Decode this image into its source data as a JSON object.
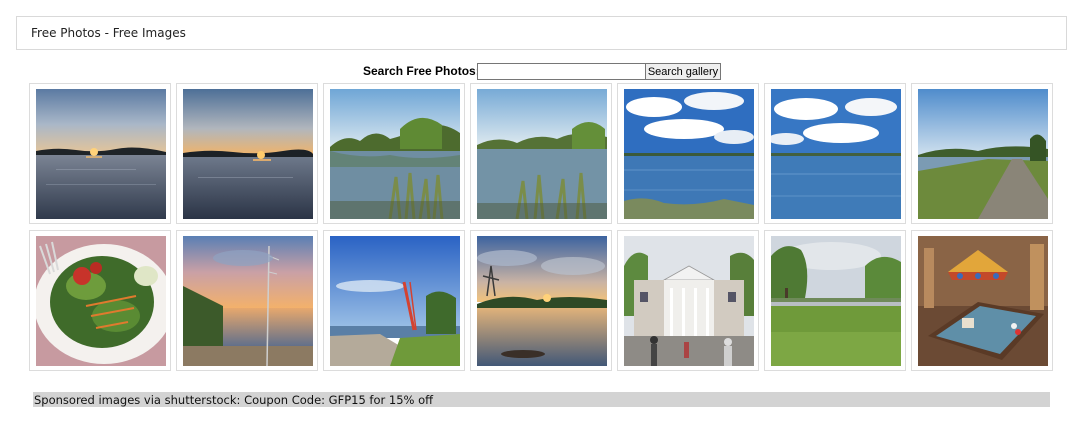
{
  "header": {
    "title": "Free Photos - Free Images"
  },
  "search": {
    "label": "Search Free Photos:",
    "value": "",
    "placeholder": "",
    "button_label": "Search gallery"
  },
  "gallery": {
    "row1": [
      "sunset-lake-1",
      "sunset-lake-2",
      "lake-reeds-1",
      "lake-reeds-2",
      "lake-clouds-1",
      "lake-clouds-2",
      "lakeside-path"
    ],
    "row2": [
      "salad-plate",
      "sunset-shoreline",
      "harbor-crane",
      "river-sunset",
      "mansion",
      "park-lawn",
      "billiards-room"
    ]
  },
  "sponsor": {
    "text": "Sponsored images via shutterstock: Coupon Code: GFP15 for 15% off"
  },
  "colors": {
    "sponsor_bg": "#d3d3d3",
    "border": "#dcdcdc"
  }
}
